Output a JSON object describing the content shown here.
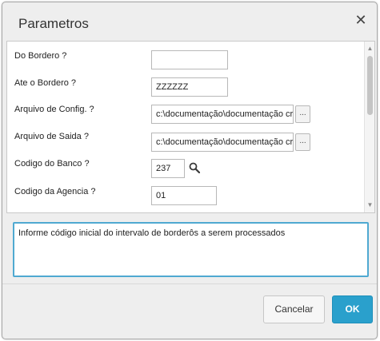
{
  "dialog": {
    "title": "Parametros",
    "close_label": "✕"
  },
  "fields": [
    {
      "label": "Do Bordero ?",
      "value": ""
    },
    {
      "label": "Ate o Bordero ?",
      "value": "ZZZZZZ"
    },
    {
      "label": "Arquivo de Config. ?",
      "value": "c:\\documentação\\documentação cr",
      "browse_label": "..."
    },
    {
      "label": "Arquivo de Saida ?",
      "value": "c:\\documentação\\documentação cr",
      "browse_label": "..."
    },
    {
      "label": "Codigo do Banco ?",
      "value": "237"
    },
    {
      "label": "Codigo da Agencia ?",
      "value": "01"
    }
  ],
  "help_text": "Informe código inicial do intervalo de borderôs a serem processados",
  "buttons": {
    "cancel": "Cancelar",
    "ok": "OK"
  },
  "colors": {
    "accent": "#2aa0cc",
    "focus_border": "#4fa9d1"
  },
  "icons": {
    "search": "magnifier-icon"
  }
}
